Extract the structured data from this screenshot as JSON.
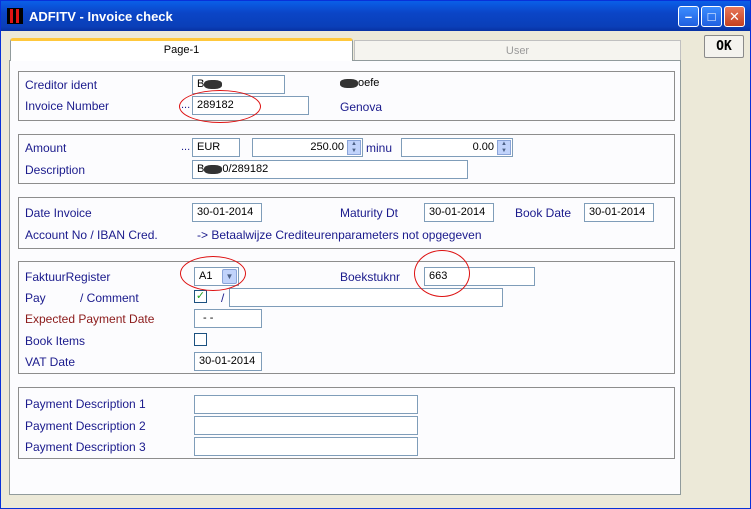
{
  "window": {
    "title": "ADFITV - Invoice check",
    "minimize_glyph": "–",
    "maximize_glyph": "□",
    "close_glyph": "✕",
    "ok_label": "OK"
  },
  "tabs": [
    {
      "label": "Page-1",
      "active": true
    },
    {
      "label": "User",
      "active": false
    }
  ],
  "creditor": {
    "ident_label": "Creditor ident",
    "ident_value": "B",
    "ident_suffix": "",
    "name_value_prefix": "",
    "name_value_suffix": "oefe",
    "invoice_label": "Invoice Number",
    "invoice_dots": "...",
    "invoice_value": "289182",
    "city": "Genova"
  },
  "amount": {
    "label": "Amount",
    "dots": "...",
    "currency": "EUR",
    "value": "250.00",
    "minus_label": "minu",
    "minus_value": "0.00",
    "description_label": "Description",
    "description_prefix": "B",
    "description_suffix": "0/289182"
  },
  "dates": {
    "invoice_label": "Date Invoice",
    "invoice_value": "30-01-2014",
    "maturity_label": "Maturity Dt",
    "maturity_value": "30-01-2014",
    "book_label": "Book Date",
    "book_value": "30-01-2014",
    "account_label": "Account No / IBAN Cred.",
    "account_message": "-> Betaalwijze Crediteurenparameters not opgegeven"
  },
  "register": {
    "faktuur_label": "FaktuurRegister",
    "faktuur_value": "A1",
    "boekstuk_label": "Boekstuknr",
    "boekstuk_value": "663",
    "pay_label": "Pay",
    "comment_label": "/ Comment",
    "pay_checked": true,
    "pay_slash": "/",
    "comment_value": "",
    "expected_label": "Expected Payment Date",
    "expected_value": "- -",
    "book_items_label": "Book Items",
    "book_items_checked": false,
    "vat_label": "VAT Date",
    "vat_value": "30-01-2014"
  },
  "payment": {
    "desc1_label": "Payment Description 1",
    "desc2_label": "Payment Description 2",
    "desc3_label": "Payment Description 3",
    "desc1_value": "",
    "desc2_value": "",
    "desc3_value": ""
  },
  "colors": {
    "label": "#1a1a8c",
    "highlight_ellipse": "#dd1111",
    "title_bar": "#0a4fd8"
  }
}
